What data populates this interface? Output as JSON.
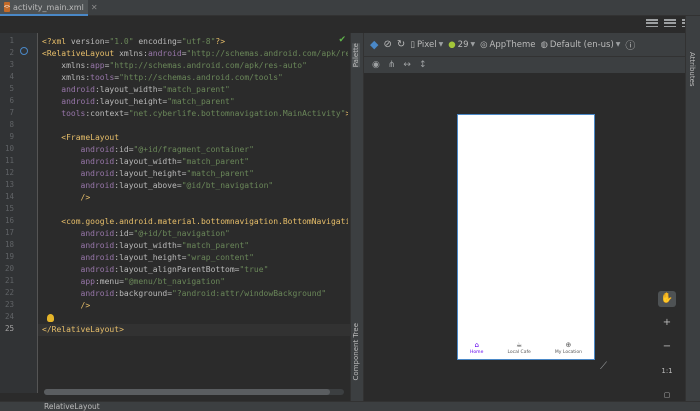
{
  "tab": {
    "title": "activity_main.xml",
    "icon": "xml-file-icon"
  },
  "editor": {
    "line_numbers": [
      "1",
      "2",
      "3",
      "4",
      "5",
      "6",
      "7",
      "8",
      "9",
      "10",
      "11",
      "12",
      "13",
      "14",
      "15",
      "16",
      "17",
      "18",
      "19",
      "20",
      "21",
      "22",
      "23",
      "24",
      "25"
    ],
    "current_line": "25",
    "lines": [
      [
        [
          "pi",
          "<?xml "
        ],
        [
          "at",
          "version="
        ],
        [
          "st",
          "\"1.0\" "
        ],
        [
          "at",
          "encoding="
        ],
        [
          "st",
          "\"utf-8\""
        ],
        [
          "pi",
          "?>"
        ]
      ],
      [
        [
          "tg",
          "<RelativeLayout "
        ],
        [
          "at",
          "xmlns:"
        ],
        [
          "ns",
          "android"
        ],
        [
          "at",
          "="
        ],
        [
          "st",
          "\"http://schemas.android.com/apk/res/"
        ]
      ],
      [
        [
          "at",
          "    xmlns:"
        ],
        [
          "ns",
          "app"
        ],
        [
          "at",
          "="
        ],
        [
          "st",
          "\"http://schemas.android.com/apk/res-auto\""
        ]
      ],
      [
        [
          "at",
          "    xmlns:"
        ],
        [
          "ns",
          "tools"
        ],
        [
          "at",
          "="
        ],
        [
          "st",
          "\"http://schemas.android.com/tools\""
        ]
      ],
      [
        [
          "ns",
          "    android"
        ],
        [
          "at",
          ":layout_width="
        ],
        [
          "st",
          "\"match_parent\""
        ]
      ],
      [
        [
          "ns",
          "    android"
        ],
        [
          "at",
          ":layout_height="
        ],
        [
          "st",
          "\"match_parent\""
        ]
      ],
      [
        [
          "ns",
          "    tools"
        ],
        [
          "at",
          ":context="
        ],
        [
          "st",
          "\"net.cyberlife.bottomnavigation.MainActivity\""
        ],
        [
          "tg",
          ">"
        ]
      ],
      [],
      [
        [
          "tg",
          "    <FrameLayout"
        ]
      ],
      [
        [
          "ns",
          "        android"
        ],
        [
          "at",
          ":id="
        ],
        [
          "st",
          "\"@+id/fragment_container\""
        ]
      ],
      [
        [
          "ns",
          "        android"
        ],
        [
          "at",
          ":layout_width="
        ],
        [
          "st",
          "\"match_parent\""
        ]
      ],
      [
        [
          "ns",
          "        android"
        ],
        [
          "at",
          ":layout_height="
        ],
        [
          "st",
          "\"match_parent\""
        ]
      ],
      [
        [
          "ns",
          "        android"
        ],
        [
          "at",
          ":layout_above="
        ],
        [
          "st",
          "\"@id/bt_navigation\""
        ]
      ],
      [
        [
          "tg",
          "        />"
        ]
      ],
      [],
      [
        [
          "tg",
          "    <com.google.android.material.bottomnavigation.BottomNavigation"
        ]
      ],
      [
        [
          "ns",
          "        android"
        ],
        [
          "at",
          ":id="
        ],
        [
          "st",
          "\"@+id/bt_navigation\""
        ]
      ],
      [
        [
          "ns",
          "        android"
        ],
        [
          "at",
          ":layout_width="
        ],
        [
          "st",
          "\"match_parent\""
        ]
      ],
      [
        [
          "ns",
          "        android"
        ],
        [
          "at",
          ":layout_height="
        ],
        [
          "st",
          "\"wrap_content\""
        ]
      ],
      [
        [
          "ns",
          "        android"
        ],
        [
          "at",
          ":layout_alignParentBottom="
        ],
        [
          "st",
          "\"true\""
        ]
      ],
      [
        [
          "ns",
          "        app"
        ],
        [
          "at",
          ":menu="
        ],
        [
          "st",
          "\"@menu/bt_navigation\""
        ]
      ],
      [
        [
          "ns",
          "        android"
        ],
        [
          "at",
          ":background="
        ],
        [
          "st",
          "\"?android:attr/windowBackground\""
        ]
      ],
      [
        [
          "tg",
          "        />"
        ]
      ],
      [],
      [
        [
          "tg",
          "</RelativeLayout>"
        ]
      ]
    ]
  },
  "side_panel": {
    "palette": "Palette",
    "component_tree": "Component Tree"
  },
  "right_panel": {
    "attributes": "Attributes"
  },
  "design_toolbar": {
    "device": "Pixel",
    "api_level": "29",
    "theme": "AppTheme",
    "locale": "Default (en-us)"
  },
  "bottom_nav": {
    "items": [
      {
        "label": "Home",
        "icon": "home-icon",
        "active": true
      },
      {
        "label": "Local Cafe",
        "icon": "cafe-icon",
        "active": false
      },
      {
        "label": "My Location",
        "icon": "location-icon",
        "active": false
      }
    ]
  },
  "zoom": {
    "plus": "+",
    "minus": "−",
    "ratio": "1:1"
  },
  "status": {
    "breadcrumb": "RelativeLayout"
  },
  "colors": {
    "accent": "#4a88c7",
    "nav_active": "#6200ee",
    "xml_tag": "#e8bf6a",
    "xml_string": "#6a8759",
    "xml_namespace": "#9876aa"
  }
}
